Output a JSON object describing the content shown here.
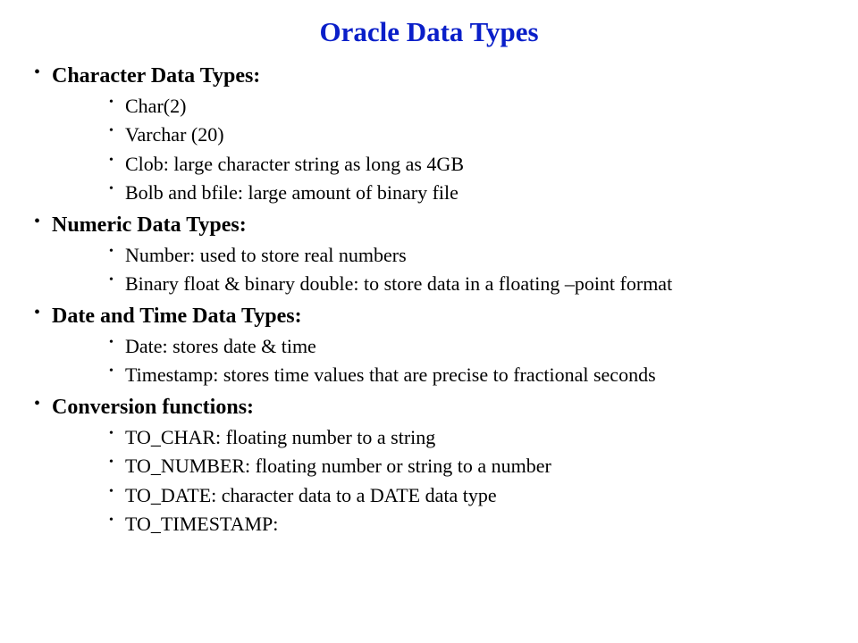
{
  "title": "Oracle Data Types",
  "sections": [
    {
      "heading": "Character Data Types:",
      "items": [
        "Char(2)",
        "Varchar (20)",
        "Clob: large character string as long as 4GB",
        "Bolb and bfile:  large amount of binary file"
      ]
    },
    {
      "heading": "Numeric Data Types:",
      "items": [
        "Number: used to store real numbers",
        "Binary float & binary double: to store data in a floating –point format"
      ]
    },
    {
      "heading": "Date and Time Data Types:",
      "items": [
        "Date: stores date & time",
        "Timestamp: stores time values that are precise to fractional seconds"
      ]
    },
    {
      "heading": "Conversion functions:",
      "items": [
        "TO_CHAR: floating number to a string",
        "TO_NUMBER: floating number or string to a number",
        "TO_DATE: character data to a DATE data type",
        "TO_TIMESTAMP:"
      ]
    }
  ]
}
